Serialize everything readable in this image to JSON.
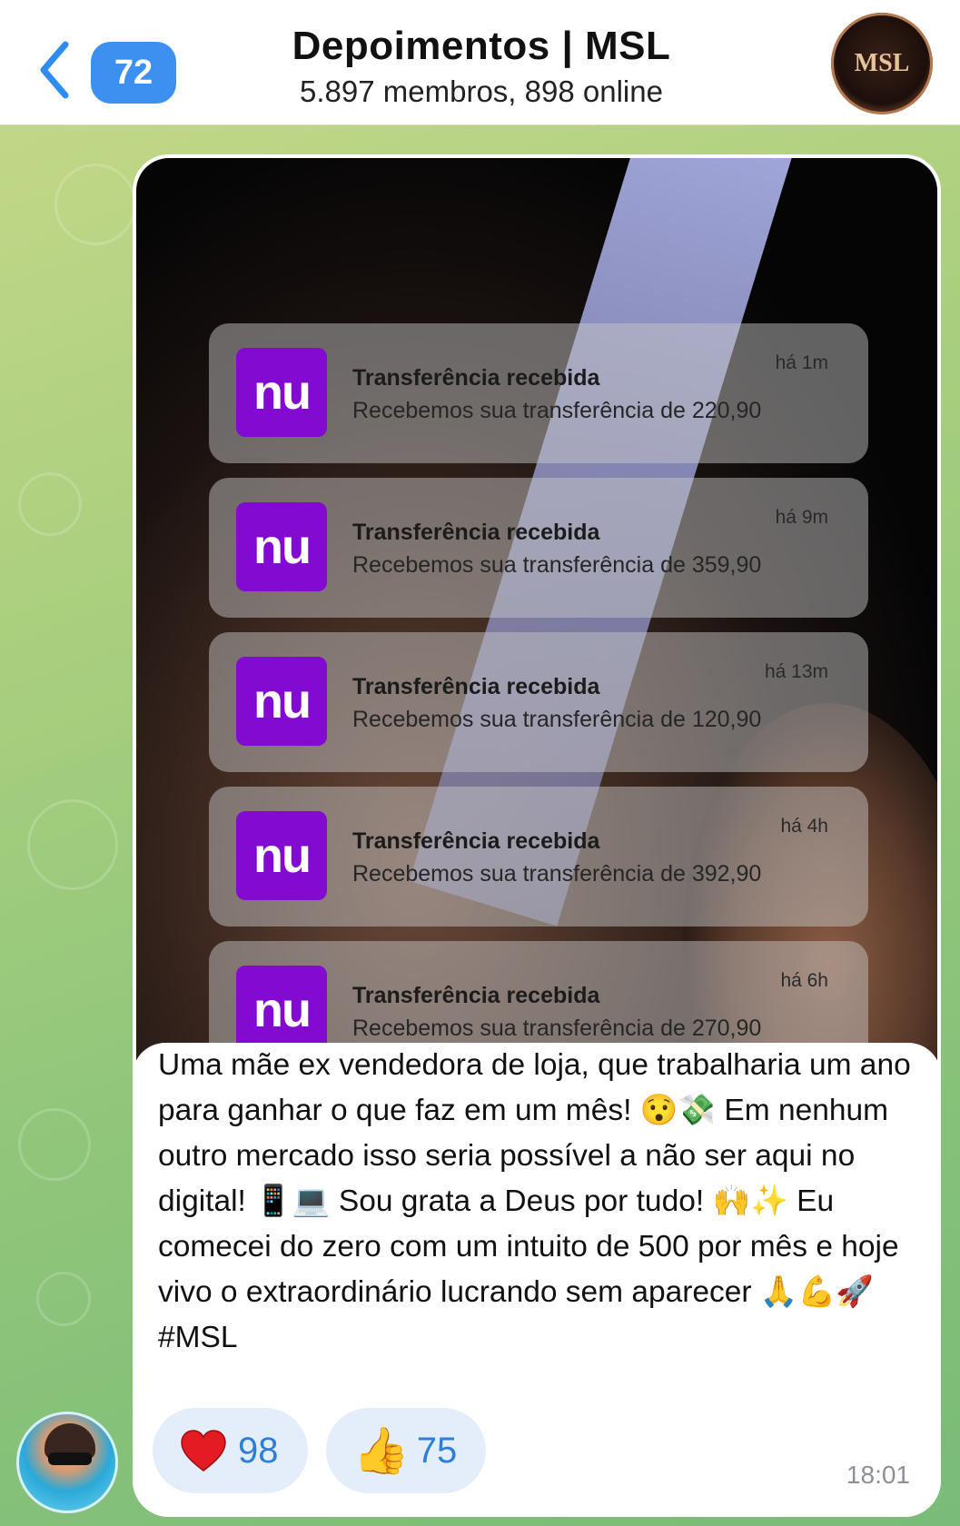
{
  "header": {
    "back_label": "Voltar",
    "unread_count": "72",
    "title": "Depoimentos | MSL",
    "subtitle": "5.897 membros, 898 online",
    "logo_text": "MSL"
  },
  "message": {
    "notifications": [
      {
        "app_icon": "nu",
        "title": "Transferência recebida",
        "body": "Recebemos sua transferência de 220,90",
        "time": "há 1m"
      },
      {
        "app_icon": "nu",
        "title": "Transferência recebida",
        "body": "Recebemos sua transferência de 359,90",
        "time": "há 9m"
      },
      {
        "app_icon": "nu",
        "title": "Transferência recebida",
        "body": "Recebemos sua transferência de 120,90",
        "time": "há 13m"
      },
      {
        "app_icon": "nu",
        "title": "Transferência recebida",
        "body": "Recebemos sua transferência de 392,90",
        "time": "há 4h"
      },
      {
        "app_icon": "nu",
        "title": "Transferência recebida",
        "body": "Recebemos sua transferência de 270,90",
        "time": "há 6h"
      }
    ],
    "caption": "Uma mãe ex vendedora de loja, que trabalharia um ano para ganhar o que faz em um mês! 😯💸 Em nenhum outro mercado isso seria possível a não ser aqui no digital! 📱💻 Sou grata a Deus por tudo! 🙌✨ Eu comecei do zero com um intuito de 500 por mês e hoje vivo o extraordinário lucrando sem aparecer 🙏💪🚀 #MSL",
    "reactions": [
      {
        "icon": "heart-icon",
        "count": "98"
      },
      {
        "icon": "thumbs-up-icon",
        "emoji": "👍",
        "count": "75"
      }
    ],
    "time": "18:01"
  },
  "colors": {
    "accent": "#3b90f0",
    "nubank_purple": "#820ad1",
    "reaction_bg": "#e3eefa",
    "reaction_count": "#2f7ed8"
  }
}
